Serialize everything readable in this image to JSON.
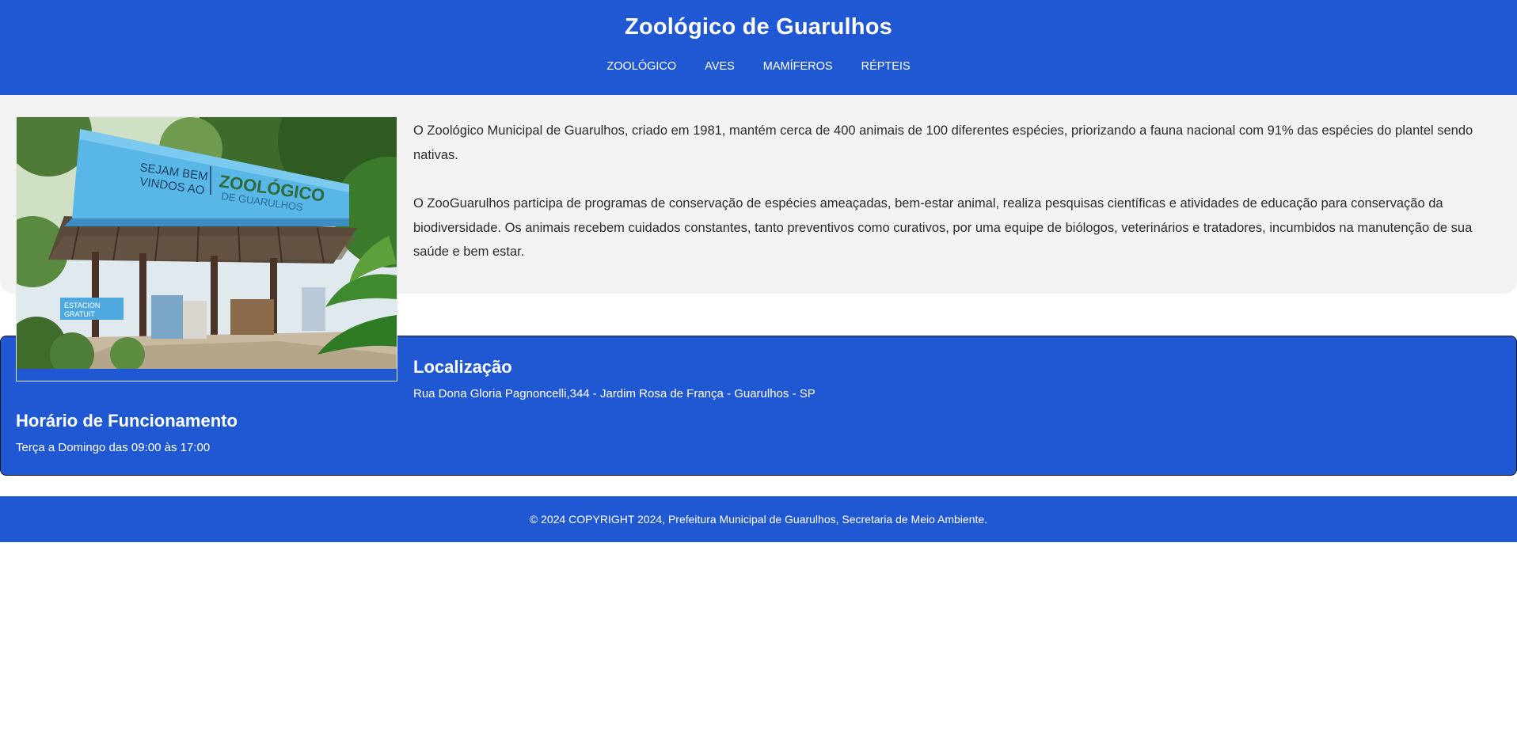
{
  "header": {
    "title": "Zoológico de Guarulhos",
    "nav": [
      "ZOOLÓGICO",
      "AVES",
      "MAMÍFEROS",
      "RÉPTEIS"
    ]
  },
  "intro": {
    "image_sign": {
      "line1": "SEJAM BEM",
      "line2": "VINDOS AO",
      "logo_main": "ZOOLÓGICO",
      "logo_sub": "DE GUARULHOS",
      "banner_left": "ESTACION",
      "banner_left_2": "GRATUIT"
    },
    "paragraphs": [
      "O Zoológico Municipal de Guarulhos, criado em 1981, mantém cerca de 400 animais de 100 diferentes espécies, priorizando a fauna nacional com 91% das espécies do plantel sendo nativas.",
      "O ZooGuarulhos participa de programas de conservação de espécies ameaçadas, bem-estar animal, realiza pesquisas científicas e atividades de educação para conservação da biodiversidade. Os animais recebem cuidados constantes, tanto preventivos como curativos, por uma equipe de biólogos, veterinários e tratadores, incumbidos na manutenção de sua saúde e bem estar."
    ]
  },
  "location": {
    "heading": "Localização",
    "address": "Rua Dona Gloria Pagnoncelli,344 - Jardim Rosa de França - Guarulhos - SP"
  },
  "hours": {
    "heading": "Horário de Funcionamento",
    "text": "Terça a Domingo das 09:00 às 17:00"
  },
  "footer": {
    "text": "© 2024 COPYRIGHT 2024, Prefeitura Municipal de Guarulhos, Secretaria de Meio Ambiente."
  },
  "colors": {
    "primary": "#2058d4",
    "light_bg": "#f3f3f3",
    "text": "#2b2b2b"
  }
}
